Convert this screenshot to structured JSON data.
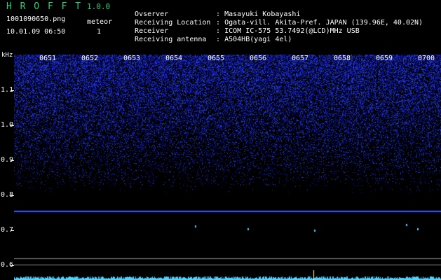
{
  "app": {
    "title": "H R O F F T",
    "version": "1.0.0",
    "file_name": "1001090650.png",
    "meteor_label": "meteor",
    "datetime": "10.01.09 06:50",
    "meteor_count": "1"
  },
  "info": [
    {
      "key": "Ovserver",
      "value": ": Masayuki Kobayashi"
    },
    {
      "key": "Receiving Location",
      "value": ": Ogata-vill. Akita-Pref. JAPAN (139.96E, 40.02N)"
    },
    {
      "key": "Receiver",
      "value": ": ICOM IC-575 53.7492(@LCD)MHz USB"
    },
    {
      "key": "Receiving antenna",
      "value": ": A504HB(yagi 4el)"
    }
  ],
  "axis": {
    "y_unit": "kHz",
    "y_ticks": [
      "1.1",
      "1.0",
      "0.9",
      "0.8",
      "0.7",
      "0.6"
    ],
    "time_labels": [
      "0651",
      "0652",
      "0653",
      "0654",
      "0655",
      "0656",
      "0657",
      "0658",
      "0659",
      "0700"
    ]
  },
  "colors": {
    "title": "#28d07a",
    "noise": "#3b49ff",
    "signal": "#4fd2ff",
    "reference": "#aaaaaa"
  }
}
